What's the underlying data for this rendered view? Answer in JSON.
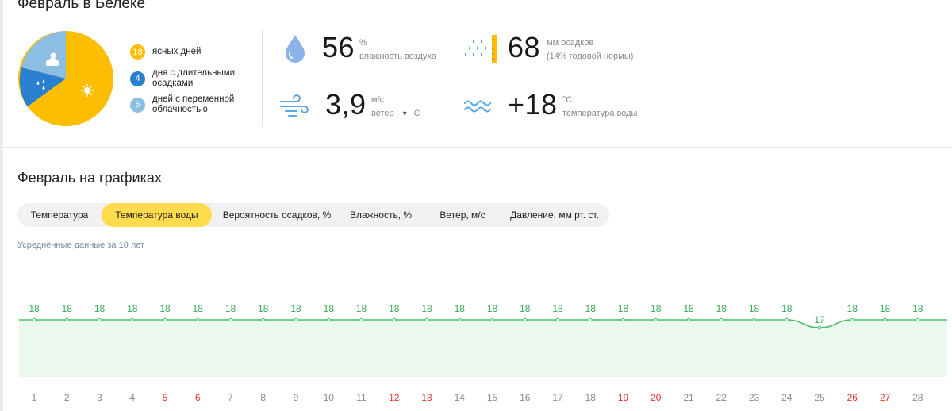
{
  "month_title": "Февраль в Белеке",
  "summary": {
    "legend": [
      {
        "count": "18",
        "label": "ясных дней",
        "color": "#fdbd00"
      },
      {
        "count": "4",
        "label": "дня с длительными осадками",
        "color": "#2a80d0"
      },
      {
        "count": "6",
        "label": "дней с переменной облачностью",
        "color": "#8cbde3"
      }
    ],
    "pie_icons": [
      "sun-icon",
      "rain-drops-icon",
      "sun-cloud-icon"
    ]
  },
  "stats": {
    "humidity": {
      "value": "56",
      "unit": "%",
      "label": "влажность воздуха"
    },
    "precipitation": {
      "value": "68",
      "unit": "мм осадков",
      "label": "(14% годовой нормы)"
    },
    "wind": {
      "value": "3,9",
      "unit": "м/с",
      "label": "ветер",
      "direction": "С"
    },
    "water": {
      "value": "+18",
      "unit": "°C",
      "label": "температура воды"
    }
  },
  "charts_section": {
    "title": "Февраль на графиках",
    "tabs": [
      "Температура",
      "Температура воды",
      "Вероятность осадков, %",
      "Влажность, %",
      "Ветер, м/с",
      "Давление, мм рт. ст."
    ],
    "active_tab": 1,
    "note": "Усреднённые данные за 10 лет"
  },
  "chart_data": {
    "type": "area",
    "x": [
      1,
      2,
      3,
      4,
      5,
      6,
      7,
      8,
      9,
      10,
      11,
      12,
      13,
      14,
      15,
      16,
      17,
      18,
      19,
      20,
      21,
      22,
      23,
      24,
      25,
      26,
      27,
      28
    ],
    "values": [
      18,
      18,
      18,
      18,
      18,
      18,
      18,
      18,
      18,
      18,
      18,
      18,
      18,
      18,
      18,
      18,
      18,
      18,
      18,
      18,
      18,
      18,
      18,
      18,
      17,
      18,
      18,
      18
    ],
    "weekend_days": [
      5,
      6,
      12,
      13,
      19,
      20,
      26,
      27
    ],
    "line_color": "#4cc16a",
    "fill_color": "#eaf8ee",
    "weekend_color": "#e2352a",
    "weekday_color": "#8a8a8a"
  }
}
